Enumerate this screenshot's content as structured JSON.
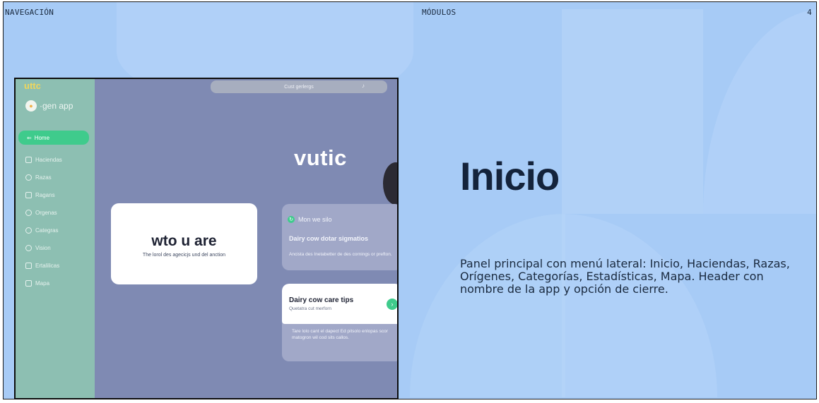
{
  "header": {
    "left": "NAVEGACIÓN",
    "middle": "MÓDULOS",
    "page_number": "4"
  },
  "slide": {
    "title": "Inicio",
    "description": "Panel principal con menú lateral: Inicio, Haciendas, Razas, Orígenes, Categorías, Estadísticas, Mapa. Header con nombre de la app y opción de cierre."
  },
  "screenshot": {
    "logo": "uttc",
    "app_name": "·gen app",
    "search_placeholder": "Cust gerlergs",
    "brand": "vutic",
    "sidebar": {
      "active": {
        "label": "Home",
        "icon": "arrow-left-icon"
      },
      "items": [
        {
          "label": "Haciendas",
          "icon": "barn-icon"
        },
        {
          "label": "Razas",
          "icon": "tag-icon"
        },
        {
          "label": "Ragans",
          "icon": "list-icon"
        },
        {
          "label": "Orgenas",
          "icon": "globe-icon"
        },
        {
          "label": "Categras",
          "icon": "gear-icon"
        },
        {
          "label": "Vision",
          "icon": "eye-icon"
        },
        {
          "label": "Ertalilicas",
          "icon": "chart-icon"
        },
        {
          "label": "Mapa",
          "icon": "map-icon"
        }
      ]
    },
    "main_card": {
      "title": "wto u are",
      "subtitle": "The lorol des agecicjs und del anction"
    },
    "card1": {
      "header": "Mon we silo",
      "title": "Dairy cow dotar sigmatios",
      "desc": "Ancista des Inetabetter de des cornings or prefton."
    },
    "card2": {
      "title": "Dairy cow care tips",
      "subtitle": "Quetatra cut merforn",
      "desc": "Tare lolo cant el dapect Ed pitsolo enlopas scor matogron wil cod sits callos."
    }
  },
  "colors": {
    "slide_bg": "#a7cbf6",
    "sidebar": "#8dbfb2",
    "accent": "#3fcb8c",
    "main_bg": "#7f8ab3"
  }
}
